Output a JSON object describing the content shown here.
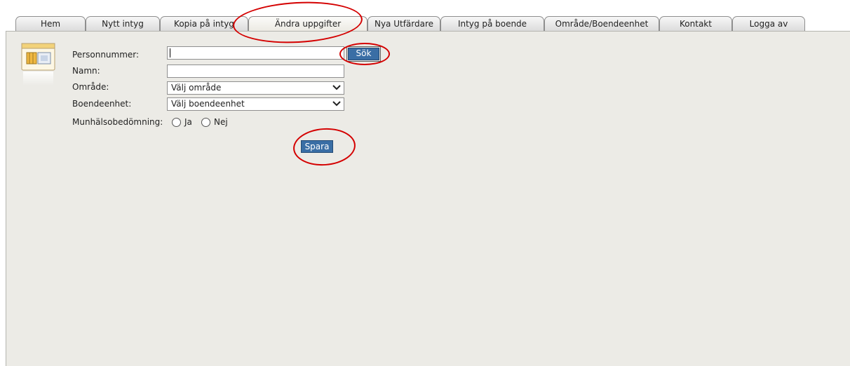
{
  "tabs": [
    {
      "label": "Hem",
      "active": false
    },
    {
      "label": "Nytt intyg",
      "active": false
    },
    {
      "label": "Kopia på intyg",
      "active": false
    },
    {
      "label": "Ändra uppgifter",
      "active": true
    },
    {
      "label": "Nya Utfärdare",
      "active": false
    },
    {
      "label": "Intyg på boende",
      "active": false
    },
    {
      "label": "Område/Boendeenhet",
      "active": false
    },
    {
      "label": "Kontakt",
      "active": false
    },
    {
      "label": "Logga av",
      "active": false
    }
  ],
  "form": {
    "personnummer_label": "Personnummer:",
    "personnummer_value": "",
    "search_button": "Sök",
    "namn_label": "Namn:",
    "namn_value": "",
    "omrade_label": "Område:",
    "omrade_selected": "Välj område",
    "boendeenhet_label": "Boendeenhet:",
    "boendeenhet_selected": "Välj boendeenhet",
    "munhalso_label": "Munhälsobedömning:",
    "radio_ja": "Ja",
    "radio_nej": "Nej",
    "save_button": "Spara"
  },
  "icons": {
    "form_icon": "address-card-icon",
    "dropdown": "chevron-down-icon",
    "radio": "radio-unchecked-icon"
  },
  "colors": {
    "button_blue": "#3a6ea5",
    "panel_bg": "#ecebe6",
    "annotation_red": "#d40000"
  }
}
